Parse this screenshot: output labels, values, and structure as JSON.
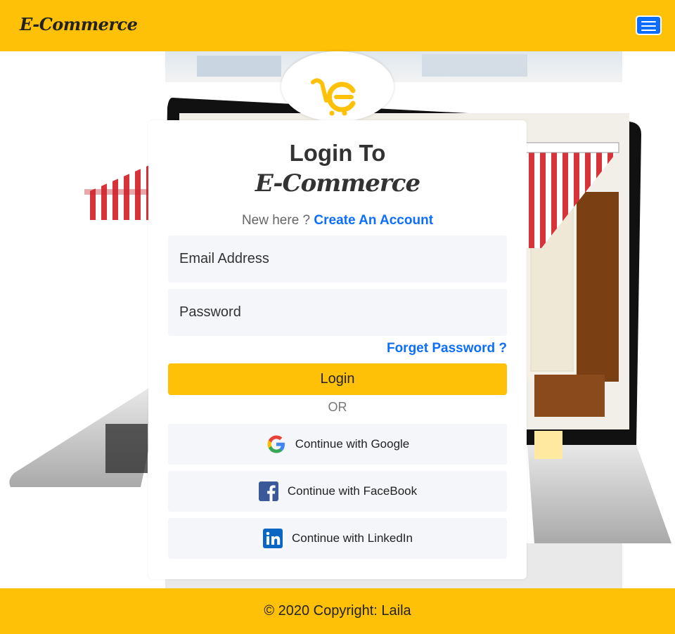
{
  "header": {
    "brand": "E-Commerce",
    "menu_icon": "hamburger-menu-icon"
  },
  "logo": {
    "icon": "cart-logo-icon",
    "color": "#ffc107"
  },
  "login_card": {
    "title": "Login To",
    "brand": "E-Commerce",
    "new_here_text": "New here ?",
    "create_account_link": "Create An Account",
    "email_placeholder": "Email Address",
    "password_placeholder": "Password",
    "forget_password_link": "Forget Password ?",
    "login_button": "Login",
    "or_divider": "OR",
    "social": {
      "google": "Continue with Google",
      "facebook": "Continue with FaceBook",
      "linkedin": "Continue with LinkedIn"
    }
  },
  "footer": {
    "copyright": "© 2020 Copyright: Laila"
  },
  "colors": {
    "accent": "#ffc107",
    "link": "#0d6efd",
    "field_bg": "#f4f6f9"
  }
}
